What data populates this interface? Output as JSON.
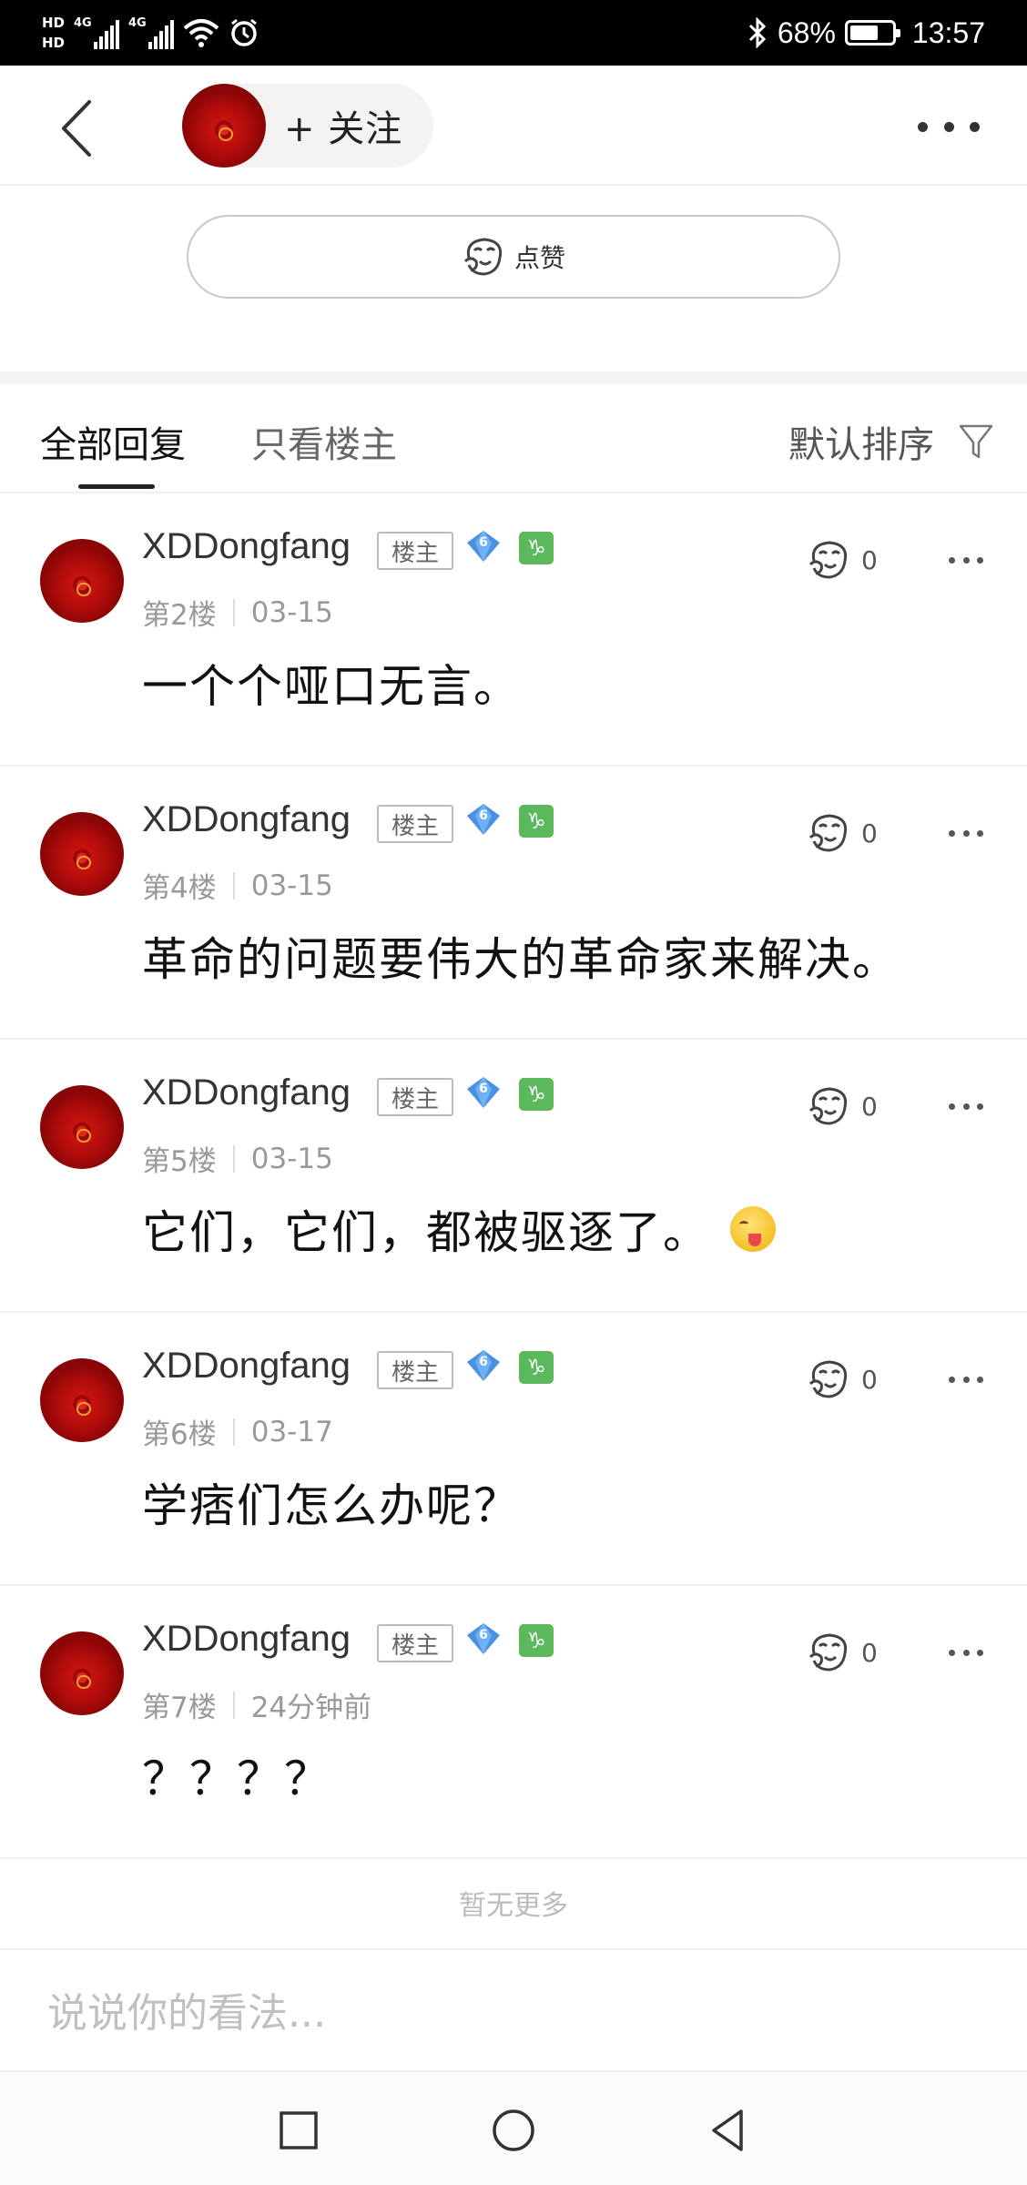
{
  "status_bar": {
    "sim1": "HD",
    "sim2": "HD",
    "net1": "4G",
    "net2": "4G",
    "battery_pct": "68%",
    "battery_level": 0.68,
    "time": "13:57"
  },
  "header": {
    "follow_label": "+ 关注"
  },
  "like_button": {
    "label": "点赞"
  },
  "tabs": {
    "all": "全部回复",
    "op_only": "只看楼主",
    "sort": "默认排序"
  },
  "replies": [
    {
      "author": "XDDongfang",
      "badge": "楼主",
      "level": "6",
      "zodiac": "♑",
      "floor": "第2楼",
      "time": "03-15",
      "likes": "0",
      "text": "一个个哑口无言。"
    },
    {
      "author": "XDDongfang",
      "badge": "楼主",
      "level": "6",
      "zodiac": "♑",
      "floor": "第4楼",
      "time": "03-15",
      "likes": "0",
      "text": "革命的问题要伟大的革命家来解决。"
    },
    {
      "author": "XDDongfang",
      "badge": "楼主",
      "level": "6",
      "zodiac": "♑",
      "floor": "第5楼",
      "time": "03-15",
      "likes": "0",
      "text": "它们，它们，都被驱逐了。"
    },
    {
      "author": "XDDongfang",
      "badge": "楼主",
      "level": "6",
      "zodiac": "♑",
      "floor": "第6楼",
      "time": "03-17",
      "likes": "0",
      "text": "学痞们怎么办呢？"
    },
    {
      "author": "XDDongfang",
      "badge": "楼主",
      "level": "6",
      "zodiac": "♑",
      "floor": "第7楼",
      "time": "24分钟前",
      "likes": "0",
      "text": "？？？？"
    }
  ],
  "footer": {
    "no_more": "暂无更多",
    "comment_placeholder": "说说你的看法..."
  },
  "icons": {
    "back": "chevron-left-icon",
    "more": "more-horizontal-icon",
    "like": "like-face-icon",
    "filter": "filter-icon",
    "gem": "diamond-level-icon",
    "emoji": "yum-emoji-icon",
    "nav_recent": "square-icon",
    "nav_home": "circle-icon",
    "nav_back": "triangle-back-icon"
  },
  "colors": {
    "status_bar_bg": "#000000",
    "avatar_red": "#b00c0b",
    "gem_blue": "#4a90e2",
    "zodiac_green": "#5cb85c",
    "muted_text": "#999999"
  }
}
